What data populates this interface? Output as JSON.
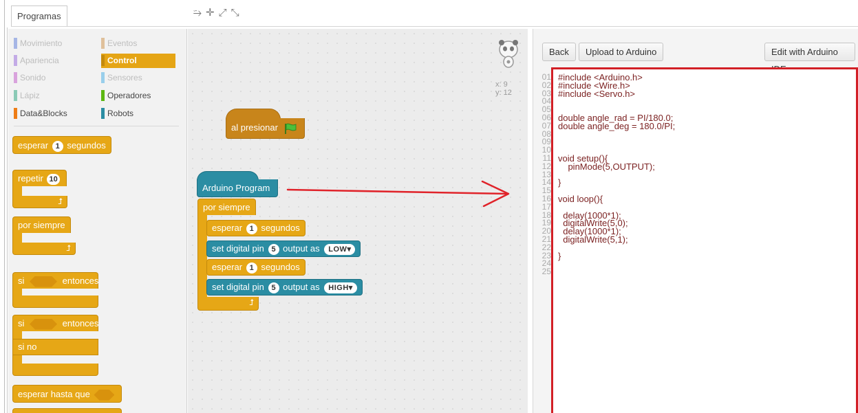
{
  "tabs": {
    "programs": "Programas"
  },
  "toolbar": {
    "icons": [
      "stamp-icon",
      "scissors-icon",
      "grow-icon",
      "shrink-icon"
    ]
  },
  "categories": [
    {
      "label": "Movimiento",
      "color": "#4a6cd4",
      "faded": true
    },
    {
      "label": "Eventos",
      "color": "#c88330",
      "faded": true
    },
    {
      "label": "Apariencia",
      "color": "#8a55d7",
      "faded": true
    },
    {
      "label": "Control",
      "color": "#e1a91a",
      "selected": true
    },
    {
      "label": "Sonido",
      "color": "#bb42c3",
      "faded": true
    },
    {
      "label": "Sensores",
      "color": "#2ca5e2",
      "faded": true
    },
    {
      "label": "Lápiz",
      "color": "#0e9a6c",
      "faded": true
    },
    {
      "label": "Operadores",
      "color": "#5cb712"
    },
    {
      "label": "Data&Blocks",
      "color": "#ee7d16"
    },
    {
      "label": "Robots",
      "color": "#2b8da3"
    }
  ],
  "palette_blocks": {
    "wait": {
      "label": "esperar",
      "value": "1",
      "unit": "segundos"
    },
    "repeat": {
      "label": "repetir",
      "value": "10"
    },
    "forever": {
      "label": "por siempre"
    },
    "if": {
      "label": "si",
      "then": "entonces"
    },
    "ifelse": {
      "label": "si",
      "then": "entonces",
      "else": "si no"
    },
    "wait_until": {
      "label": "esperar hasta que"
    }
  },
  "canvas": {
    "hat_flag": {
      "label": "al presionar"
    },
    "program": {
      "hat": "Arduino Program",
      "forever": "por siempre",
      "wait1": {
        "label": "esperar",
        "value": "1",
        "unit": "segundos"
      },
      "set1": {
        "label": "set digital pin",
        "pin": "5",
        "mid": "output as",
        "level": "LOW"
      },
      "wait2": {
        "label": "esperar",
        "value": "1",
        "unit": "segundos"
      },
      "set2": {
        "label": "set digital pin",
        "pin": "5",
        "mid": "output as",
        "level": "HIGH"
      }
    },
    "coords": {
      "x": "x: 9",
      "y": "y: 12"
    }
  },
  "code_panel": {
    "back": "Back",
    "upload": "Upload to Arduino",
    "edit": "Edit with Arduino IDE",
    "line_numbers": [
      "01",
      "02",
      "03",
      "04",
      "05",
      "06",
      "07",
      "08",
      "09",
      "10",
      "11",
      "12",
      "13",
      "14",
      "15",
      "16",
      "17",
      "18",
      "19",
      "20",
      "21",
      "22",
      "23",
      "24",
      "25"
    ],
    "lines": [
      "#include <Arduino.h>",
      "#include <Wire.h>",
      "#include <Servo.h>",
      "",
      "",
      "double angle_rad = PI/180.0;",
      "double angle_deg = 180.0/PI;",
      "",
      "",
      "",
      "void setup(){",
      "    pinMode(5,OUTPUT);",
      "",
      "}",
      "",
      "void loop(){",
      "",
      "  delay(1000*1);",
      "  digitalWrite(5,0);",
      "  delay(1000*1);",
      "  digitalWrite(5,1);",
      "",
      "}",
      "",
      ""
    ]
  },
  "colors": {
    "control": "#e6a716",
    "robots": "#2b8da3",
    "highlight_border": "#d21f26",
    "arrow": "#e0232a"
  }
}
